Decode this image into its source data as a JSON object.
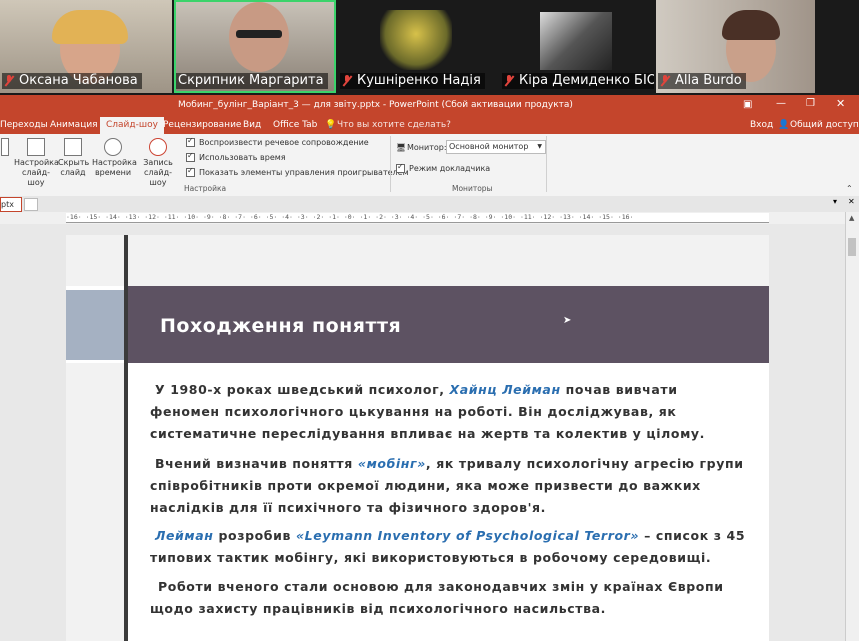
{
  "participants": [
    {
      "name": "Оксана Чабанова"
    },
    {
      "name": "Скрипник Маргарита"
    },
    {
      "name": "Кушніренко Надія"
    },
    {
      "name": "Кіра Демиденко БІО-..."
    },
    {
      "name": "Alla Burdo"
    }
  ],
  "ppt": {
    "window_title": "Мобинг_булінг_Варіант_3 — для звіту.pptx - PowerPoint (Сбой активации продукта)",
    "tabs": [
      "Переходы",
      "Анимация",
      "Слайд-шоу",
      "Рецензирование",
      "Вид",
      "Office Tab"
    ],
    "selected_tab": "Слайд-шоу",
    "tell_me": "Что вы хотите сделать?",
    "login": "Вход",
    "share": "Общий доступ",
    "ribbon": {
      "btn_setup": "Настройка слайд-шоу",
      "btn_hide": "Скрыть слайд",
      "btn_timing": "Настройка времени",
      "btn_record": "Запись слайд-шоу",
      "chk1": "Воспроизвести речевое сопровождение",
      "chk2": "Использовать время",
      "chk3": "Показать элементы управления проигрывателем",
      "group_setup": "Настройка",
      "monitor_label": "Монитор:",
      "monitor_value": "Основной монитор",
      "presenter": "Режим докладчика",
      "group_monitors": "Мониторы"
    },
    "doc_tab": "ptx",
    "ruler": "·16·  ·15·  ·14·  ·13·  ·12·  ·11·  ·10·  ·9·  ·8·  ·7·  ·6·  ·5·  ·4·  ·3·  ·2·  ·1·  ·0·  ·1·  ·2·  ·3·  ·4·  ·5·  ·6·  ·7·  ·8·  ·9·  ·10·  ·11·  ·12·  ·13·  ·14·  ·15·  ·16·"
  },
  "slide": {
    "title": "Походження поняття",
    "p1": [
      "У 1980-х роках шведський психолог, ",
      "Хайнц Лейман",
      " почав вивчати феномен психологічного цькування на роботі. Він досліджував, як систематичне переслідування впливає на жертв та колектив у цілому."
    ],
    "p2": [
      "Вчений визначив поняття ",
      "«мобінг»",
      ", як тривалу психологічну агресію групи співробітників проти окремої людини, яка може призвести до важких наслідків для її психічного та фізичного здоров'я."
    ],
    "p3": [
      "Лейман",
      " розробив ",
      "«Leymann Inventory of Psychological Terror»",
      " – список з 45 типових тактик мобінгу, які використовуються в робочому середовищі."
    ],
    "p4": "Роботи вченого стали основою для законодавчих змін у країнах Європи щодо захисту працівників від психологічного насильства."
  }
}
